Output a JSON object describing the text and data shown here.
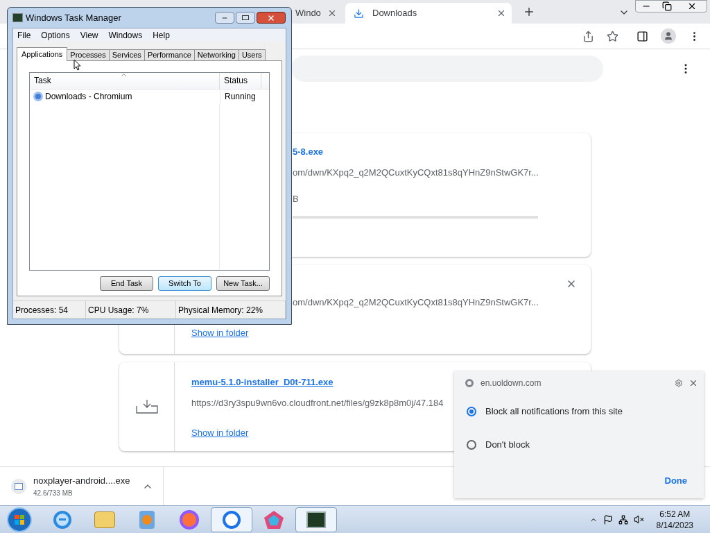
{
  "browser": {
    "tabs": [
      {
        "title": "Windo",
        "selected": false
      },
      {
        "title": "Downloads",
        "selected": true
      }
    ]
  },
  "downloads": [
    {
      "name": "5-8.exe",
      "url": "om/dwn/KXpq2_q2M2QCuxtKyCQxt81s8qYHnZ9nStwGK7r...",
      "status": "B"
    },
    {
      "url": "om/dwn/KXpq2_q2M2QCuxtKyCQxt81s8qYHnZ9nStwGK7r...",
      "link": "Show in folder"
    },
    {
      "name": "memu-5.1.0-installer_D0t-711.exe",
      "url": "https://d3ry3spu9wn6vo.cloudfront.net/files/g9zk8p8m0j/47.184",
      "link": "Show in folder"
    }
  ],
  "download_shelf": {
    "name": "noxplayer-android....exe",
    "size": "42.6/733 MB"
  },
  "notification_popup": {
    "site": "en.uoldown.com",
    "options": [
      {
        "label": "Block all notifications from this site",
        "selected": true
      },
      {
        "label": "Don't block",
        "selected": false
      }
    ],
    "button": "Done"
  },
  "task_manager": {
    "title": "Windows Task Manager",
    "menu": [
      "File",
      "Options",
      "View",
      "Windows",
      "Help"
    ],
    "tabs": [
      {
        "label": "Applications",
        "selected": true
      },
      {
        "label": "Processes",
        "selected": false
      },
      {
        "label": "Services",
        "selected": false
      },
      {
        "label": "Performance",
        "selected": false
      },
      {
        "label": "Networking",
        "selected": false
      },
      {
        "label": "Users",
        "selected": false
      }
    ],
    "columns": [
      "Task",
      "Status"
    ],
    "rows": [
      {
        "task": "Downloads - Chromium",
        "status": "Running"
      }
    ],
    "buttons": [
      {
        "label": "End Task",
        "selected": false
      },
      {
        "label": "Switch To",
        "selected": true
      },
      {
        "label": "New Task...",
        "selected": false
      }
    ],
    "status_bar": [
      "Processes: 54",
      "CPU Usage: 7%",
      "Physical Memory: 22%"
    ]
  },
  "taskbar": {
    "apps": [
      {
        "kind": "ie",
        "selected": false
      },
      {
        "kind": "folder",
        "selected": false
      },
      {
        "kind": "media",
        "selected": false
      },
      {
        "kind": "firefox",
        "selected": false
      },
      {
        "kind": "chrome",
        "selected": true
      },
      {
        "kind": "pentagon",
        "selected": false
      },
      {
        "kind": "taskmgr",
        "selected": true
      }
    ],
    "time": "6:52 AM",
    "date": "8/14/2023"
  }
}
